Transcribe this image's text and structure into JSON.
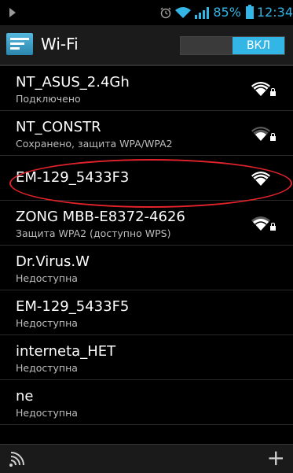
{
  "status_bar": {
    "battery_percent": "85%",
    "time": "12:34"
  },
  "action_bar": {
    "title": "Wi-Fi",
    "toggle_label": "ВКЛ"
  },
  "networks": [
    {
      "name": "NT_ASUS_2.4Gh",
      "status": "Подключено",
      "secured": true,
      "signal": "strong"
    },
    {
      "name": "NT_CONSTR",
      "status": "Сохранено, защита WPA/WPA2",
      "secured": true,
      "signal": "medium"
    },
    {
      "name": "EM-129_5433F3",
      "status": "",
      "secured": false,
      "signal": "strong"
    },
    {
      "name": "ZONG MBB-E8372-4626",
      "status": "Защита WPA2 (доступно WPS)",
      "secured": true,
      "signal": "medium"
    },
    {
      "name": "Dr.Virus.W",
      "status": "Недоступна"
    },
    {
      "name": "EM-129_5433F5",
      "status": "Недоступна"
    },
    {
      "name": "interneta_HET",
      "status": "Недоступна"
    },
    {
      "name": "ne",
      "status": "Недоступна"
    }
  ],
  "bottom_bar": {
    "add_label": "+"
  },
  "colors": {
    "accent": "#33b5e5",
    "highlight_oval": "#e3232b"
  }
}
